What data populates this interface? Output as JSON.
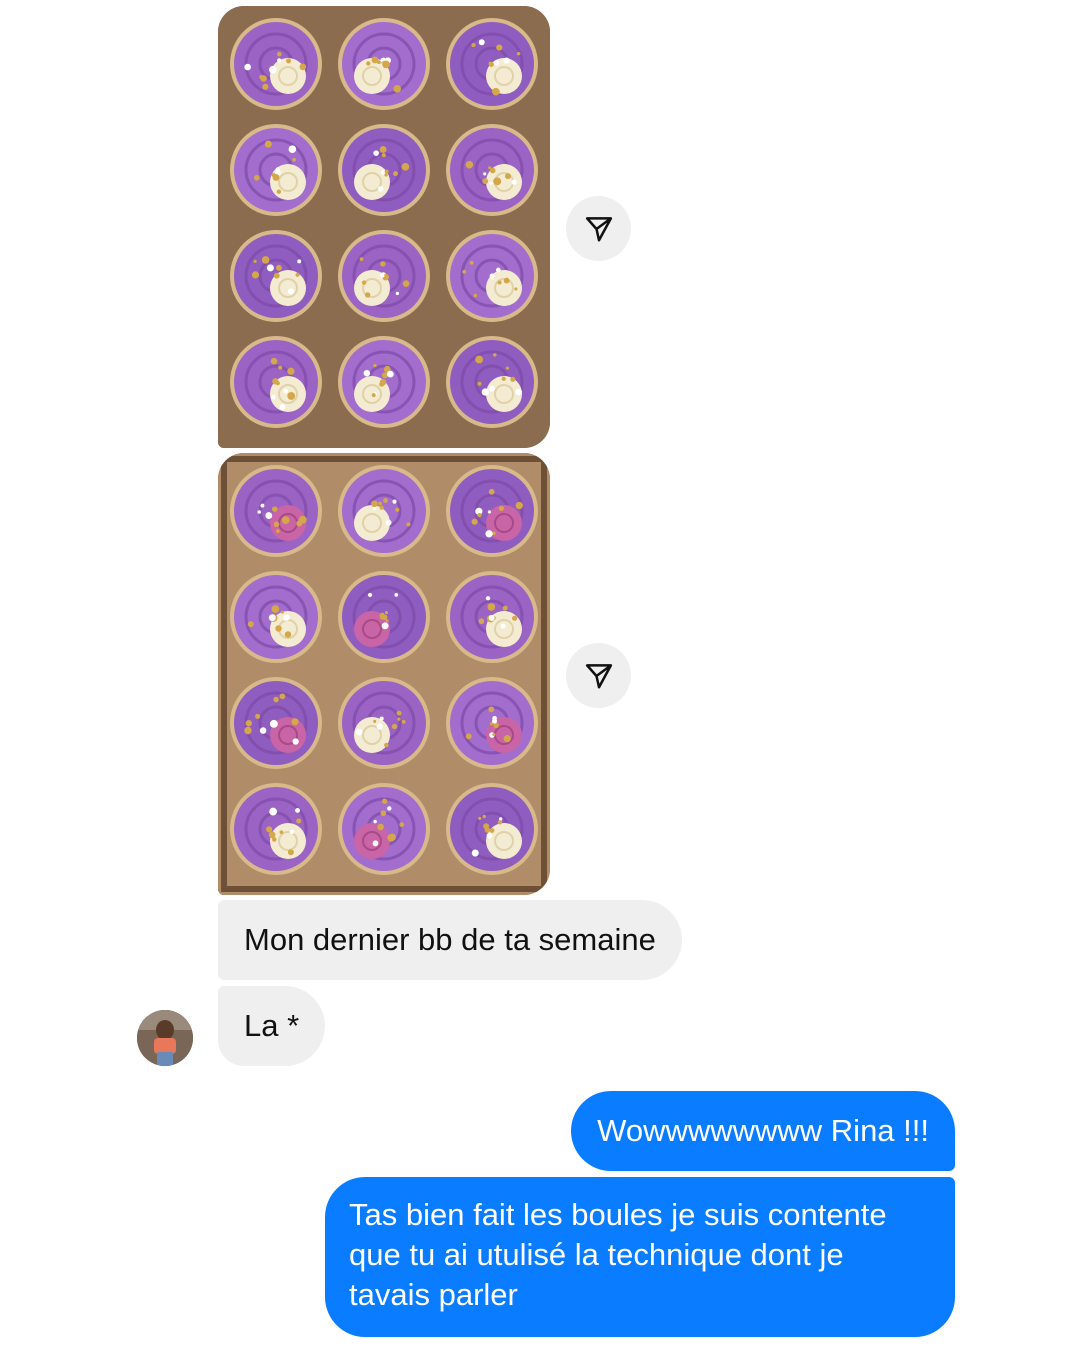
{
  "conversation": {
    "attachments": [
      {
        "description": "photo",
        "share_icon": "send-icon"
      },
      {
        "description": "photo",
        "share_icon": "send-icon"
      }
    ],
    "messages": [
      {
        "from": "contact",
        "text": "Mon dernier bb de ta semaine"
      },
      {
        "from": "contact",
        "text": "La *"
      },
      {
        "from": "me",
        "text": "Wowwwwwwww Rina !!!"
      },
      {
        "from": "me",
        "text": "Tas bien fait les boules je suis contente que tu ai utulisé la technique dont je tavais parler"
      }
    ],
    "contact_avatar": "avatar"
  },
  "colors": {
    "incoming_bubble": "#efefef",
    "outgoing_bubble": "#0a7cff",
    "share_button": "#efefef"
  }
}
